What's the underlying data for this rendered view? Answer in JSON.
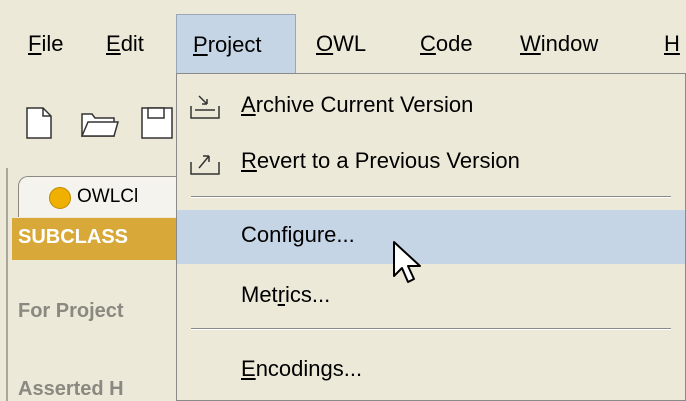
{
  "menubar": {
    "items": [
      {
        "mnemonic": "F",
        "rest": "ile"
      },
      {
        "mnemonic": "E",
        "rest": "dit"
      },
      {
        "mnemonic": "P",
        "rest": "roject"
      },
      {
        "mnemonic": "O",
        "rest": "WL"
      },
      {
        "mnemonic": "C",
        "rest": "ode"
      },
      {
        "mnemonic": "W",
        "rest": "indow"
      },
      {
        "mnemonic": "H",
        "rest": ""
      }
    ]
  },
  "toolbar": {
    "icons": [
      "new-file-icon",
      "open-folder-icon",
      "save-icon"
    ]
  },
  "tab": {
    "label": "OWLCl",
    "status_color": "#f0b000"
  },
  "panel": {
    "subclass_text": "SUBCLASS",
    "for_project_text": "For Project",
    "asserted_text": "Asserted H"
  },
  "dropdown": {
    "archive": {
      "mnemonic": "A",
      "rest": "rchive Current Version",
      "icon": "archive-icon"
    },
    "revert": {
      "mnemonic": "R",
      "rest": "evert to a Previous Version",
      "icon": "revert-icon"
    },
    "configure": {
      "label": "Configure..."
    },
    "metrics": {
      "before": "Met",
      "mnemonic": "r",
      "rest": "ics..."
    },
    "encodings": {
      "mnemonic": "E",
      "rest": "ncodings..."
    }
  },
  "colors": {
    "menu_highlight": "#c6d5e6",
    "subclass_bar": "#d8a838",
    "background": "#ece9d8"
  }
}
